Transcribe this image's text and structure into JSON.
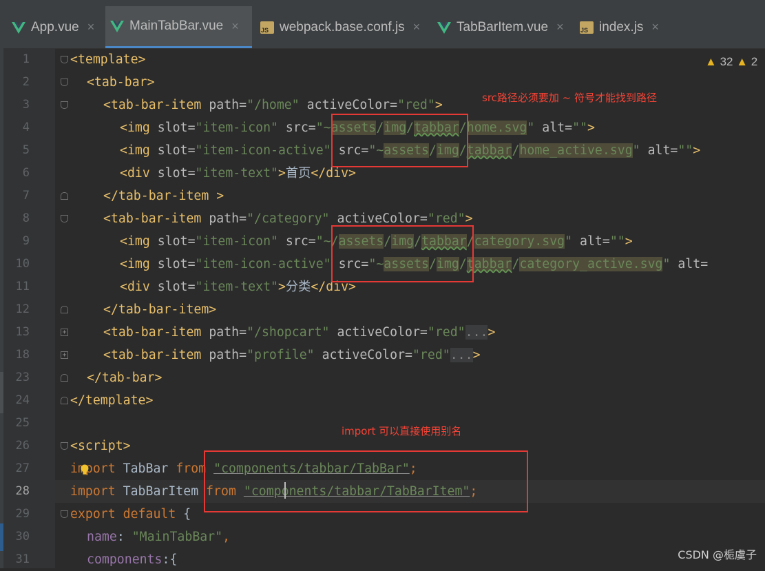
{
  "tabs": [
    {
      "label": "App.vue",
      "icon": "vue-icon",
      "active": false
    },
    {
      "label": "MainTabBar.vue",
      "icon": "vue-icon",
      "active": true
    },
    {
      "label": "webpack.base.conf.js",
      "icon": "js-file-icon",
      "active": false
    },
    {
      "label": "TabBarItem.vue",
      "icon": "vue-icon",
      "active": false
    },
    {
      "label": "index.js",
      "icon": "js-file-icon",
      "active": false
    }
  ],
  "tab_close_glyph": "×",
  "js_badge": "JS",
  "line_numbers": [
    "1",
    "2",
    "3",
    "4",
    "5",
    "6",
    "7",
    "8",
    "9",
    "10",
    "11",
    "12",
    "13",
    "18",
    "23",
    "24",
    "25",
    "26",
    "27",
    "28",
    "29",
    "30",
    "31"
  ],
  "warnings": {
    "warning_count": "32",
    "second_count": "2"
  },
  "annotations": {
    "src_note": "src路径必须要加 ~ 符号才能找到路径",
    "import_note": "import 可以直接使用别名"
  },
  "code": {
    "l1": {
      "tag": "<template>"
    },
    "l2": {
      "tag": "<tab-bar>"
    },
    "l3": {
      "tag": "<tab-bar-item",
      "attr1": "path=",
      "val1": "\"/home\"",
      "attr2": "activeColor=",
      "val2": "\"red\"",
      "end": ">"
    },
    "l4": {
      "tag": "<img",
      "attr1": "slot=",
      "val1": "\"item-icon\"",
      "attr2": "src=",
      "q": "\"",
      "tilde": "~",
      "p1": "assets",
      "p2": "/",
      "p3": "img",
      "p4": "/",
      "p5": "tabbar",
      "p6": "/",
      "p7": "home.svg",
      "q2": "\"",
      "attr3": "alt=",
      "val3": "\"\"",
      "end": ">"
    },
    "l5": {
      "tag": "<img",
      "attr1": "slot=",
      "val1": "\"item-icon-active\"",
      "attr2": "src=",
      "q": "\"",
      "tilde": "~",
      "p1": "assets",
      "p2": "/",
      "p3": "img",
      "p4": "/",
      "p5": "tabbar",
      "p6": "/",
      "p7": "home_active.svg",
      "q2": "\"",
      "attr3": "alt=",
      "val3": "\"\"",
      "end": ">"
    },
    "l6": {
      "tag": "<div",
      "attr1": "slot=",
      "val1": "\"item-text\"",
      "end": ">",
      "text": "首页",
      "close": "</div>"
    },
    "l7": {
      "tag": "</tab-bar-item",
      "end": " >"
    },
    "l8": {
      "tag": "<tab-bar-item",
      "attr1": "path=",
      "val1": "\"/category\"",
      "attr2": "activeColor=",
      "val2": "\"red\"",
      "end": ">"
    },
    "l9": {
      "tag": "<img",
      "attr1": "slot=",
      "val1": "\"item-icon\"",
      "attr2": "src=",
      "q": "\"",
      "tilde": "~/",
      "p1": "assets",
      "p2": "/",
      "p3": "img",
      "p4": "/",
      "p5": "tabbar",
      "p6": "/",
      "p7": "category.svg",
      "q2": "\"",
      "attr3": "alt=",
      "val3": "\"\"",
      "end": ">"
    },
    "l10": {
      "tag": "<img",
      "attr1": "slot=",
      "val1": "\"item-icon-active\"",
      "attr2": "src=",
      "q": "\"",
      "tilde": "~",
      "p1": "assets",
      "p2": "/",
      "p3": "img",
      "p4": "/",
      "p5": "tabbar",
      "p6": "/",
      "p7": "category_active.svg",
      "q2": "\"",
      "attr3": "alt="
    },
    "l11": {
      "tag": "<div",
      "attr1": "slot=",
      "val1": "\"item-text\"",
      "end": ">",
      "text": "分类",
      "close": "</div>"
    },
    "l12": {
      "tag": "</tab-bar-item>"
    },
    "l13": {
      "tag": "<tab-bar-item",
      "attr1": "path=",
      "val1": "\"/shopcart\"",
      "attr2": "activeColor=",
      "val2": "\"red\"",
      "fold": "...",
      "end": ">"
    },
    "l18": {
      "tag": "<tab-bar-item",
      "attr1": "path=",
      "val1": "\"profile\"",
      "attr2": "activeColor=",
      "val2": "\"red\"",
      "fold": "...",
      "end": ">"
    },
    "l23": {
      "tag": "</tab-bar>"
    },
    "l24": {
      "tag": "</template>"
    },
    "l26": {
      "tag": "<script>"
    },
    "l27": {
      "kw1": "import",
      "ident": " TabBar ",
      "kw2": "from",
      "str": "\"components/tabbar/TabBar\"",
      "semi": ";"
    },
    "l28": {
      "kw1": "import",
      "ident": " TabBarItem ",
      "kw2": "from",
      "str": "\"components/tabbar/TabBarItem\"",
      "semi": ";"
    },
    "l29": {
      "kw1": "export default",
      "rest": " {"
    },
    "l30": {
      "prop": "name",
      "colon": ": ",
      "str": "\"MainTabBar\"",
      "comma": ","
    },
    "l31": {
      "prop": "components",
      "rest": ":{"
    }
  },
  "watermark": "CSDN @栀虞子"
}
